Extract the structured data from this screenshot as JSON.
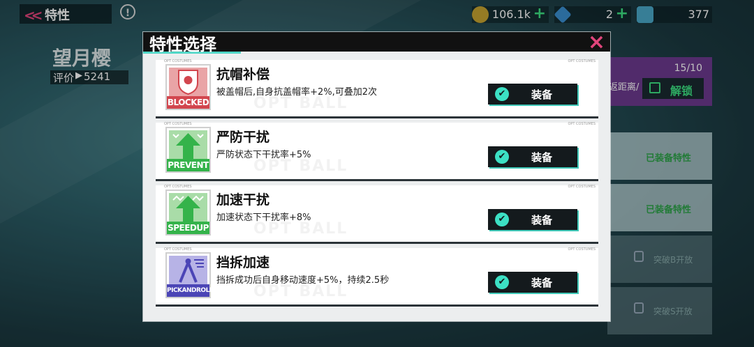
{
  "header": {
    "title": "特性",
    "info_icon": "!"
  },
  "resources": [
    {
      "icon": "coin-icon",
      "value": "106.1k",
      "plus": "+"
    },
    {
      "icon": "diamond-icon",
      "value": "2",
      "plus": "+"
    },
    {
      "icon": "lock-gem-icon",
      "value": "377"
    }
  ],
  "character": {
    "name": "望月樱",
    "rating_label": "评价",
    "rating_value": "5241"
  },
  "background_panel": {
    "count": "15/10",
    "distance_text": "返距离/",
    "unlock_label": "解锁",
    "rows": [
      {
        "text": "已装备特性",
        "locked": false
      },
      {
        "text": "已装备特性",
        "locked": false
      },
      {
        "text": "突破B开放",
        "locked": true
      },
      {
        "text": "突破S开放",
        "locked": true
      }
    ]
  },
  "modal": {
    "title": "特性选择",
    "close_icon": "×",
    "equip_label": "装备",
    "check_glyph": "✔",
    "tag_text": "OPT COSTUMES",
    "watermark": "OPT BALL",
    "traits": [
      {
        "name": "抗帽补偿",
        "desc": "被盖帽后,自身抗盖帽率+2%,可叠加2次",
        "badge": "BLOCKED",
        "color": "#d2464e",
        "icon": "blocked-badge-icon"
      },
      {
        "name": "严防干扰",
        "desc": "严防状态下干扰率+5%",
        "badge": "PREVENT",
        "color": "#34b34a",
        "icon": "prevent-badge-icon"
      },
      {
        "name": "加速干扰",
        "desc": "加速状态下干扰率+8%",
        "badge": "SPEEDUP",
        "color": "#34b34a",
        "icon": "speedup-badge-icon"
      },
      {
        "name": "挡拆加速",
        "desc": "挡拆成功后自身移动速度+5%，持续2.5秒",
        "badge": "PICKANDROLL",
        "color": "#4b45b6",
        "icon": "pickandroll-badge-icon"
      }
    ]
  }
}
